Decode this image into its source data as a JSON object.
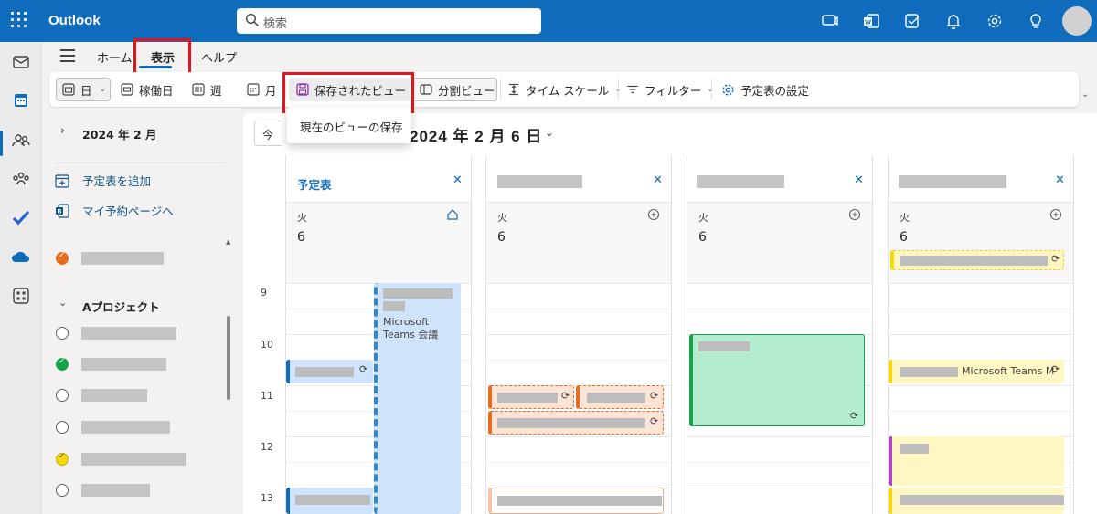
{
  "topbar": {
    "app_title": "Outlook",
    "search_placeholder": "検索"
  },
  "menu": {
    "tabs": [
      "ホーム",
      "表示",
      "ヘルプ"
    ]
  },
  "ribbon": {
    "day": "日",
    "workweek": "稼働日",
    "week": "週",
    "month": "月",
    "saved_views": "保存されたビュー",
    "split_view": "分割ビュー",
    "time_scale": "タイム スケール",
    "filter": "フィルター",
    "calendar_settings": "予定表の設定"
  },
  "dropdown": {
    "save_current_view": "現在のビューの保存"
  },
  "folder_pane": {
    "month_label": "2024 年 2 月",
    "add_calendar": "予定表を追加",
    "booking_page": "マイ予約ページへ",
    "group_label": "Aプロジェクト",
    "calendar_colors": [
      "#e86c1f",
      "#ffffff",
      "#16a34a",
      "#ffffff",
      "#ffffff",
      "#f5d90a",
      "#ffffff"
    ]
  },
  "calendar": {
    "today_label": "今日",
    "date_title": "2024 年 2 月 6 日",
    "hours": [
      "9",
      "10",
      "11",
      "12",
      "13"
    ],
    "columns": [
      {
        "name": "予定表",
        "weekday": "火",
        "day": "6"
      },
      {
        "name": "",
        "weekday": "火",
        "day": "6"
      },
      {
        "name": "",
        "weekday": "火",
        "day": "6"
      },
      {
        "name": "",
        "weekday": "火",
        "day": "6"
      }
    ],
    "events": {
      "teams_meeting": "Microsoft Teams 会議",
      "teams_meeting_short": "Microsoft Teams M"
    }
  }
}
